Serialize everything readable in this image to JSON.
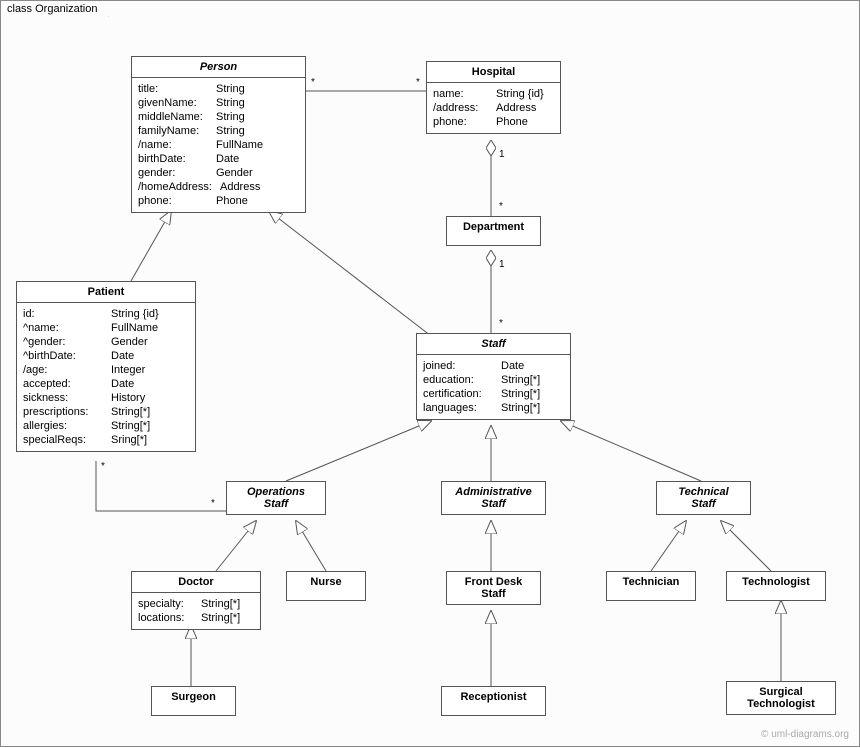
{
  "frame": {
    "label": "class Organization"
  },
  "watermark": "© uml-diagrams.org",
  "classes": {
    "person": {
      "name": "Person",
      "attrs": [
        {
          "n": "title:",
          "t": "String"
        },
        {
          "n": "givenName:",
          "t": "String"
        },
        {
          "n": "middleName:",
          "t": "String"
        },
        {
          "n": "familyName:",
          "t": "String"
        },
        {
          "n": "/name:",
          "t": "FullName"
        },
        {
          "n": "birthDate:",
          "t": "Date"
        },
        {
          "n": "gender:",
          "t": "Gender"
        },
        {
          "n": "/homeAddress:",
          "t": "Address"
        },
        {
          "n": "phone:",
          "t": "Phone"
        }
      ]
    },
    "hospital": {
      "name": "Hospital",
      "attrs": [
        {
          "n": "name:",
          "t": "String {id}"
        },
        {
          "n": "/address:",
          "t": "Address"
        },
        {
          "n": "phone:",
          "t": "Phone"
        }
      ]
    },
    "department": {
      "name": "Department"
    },
    "patient": {
      "name": "Patient",
      "attrs": [
        {
          "n": "id:",
          "t": "String {id}"
        },
        {
          "n": "^name:",
          "t": "FullName"
        },
        {
          "n": "^gender:",
          "t": "Gender"
        },
        {
          "n": "^birthDate:",
          "t": "Date"
        },
        {
          "n": "/age:",
          "t": "Integer"
        },
        {
          "n": "accepted:",
          "t": "Date"
        },
        {
          "n": "sickness:",
          "t": "History"
        },
        {
          "n": "prescriptions:",
          "t": "String[*]"
        },
        {
          "n": "allergies:",
          "t": "String[*]"
        },
        {
          "n": "specialReqs:",
          "t": "Sring[*]"
        }
      ]
    },
    "staff": {
      "name": "Staff",
      "attrs": [
        {
          "n": "joined:",
          "t": "Date"
        },
        {
          "n": "education:",
          "t": "String[*]"
        },
        {
          "n": "certification:",
          "t": "String[*]"
        },
        {
          "n": "languages:",
          "t": "String[*]"
        }
      ]
    },
    "operationsStaff": {
      "name": "Operations",
      "name2": "Staff"
    },
    "administrativeStaff": {
      "name": "Administrative",
      "name2": "Staff"
    },
    "technicalStaff": {
      "name": "Technical",
      "name2": "Staff"
    },
    "doctor": {
      "name": "Doctor",
      "attrs": [
        {
          "n": "specialty:",
          "t": "String[*]"
        },
        {
          "n": "locations:",
          "t": "String[*]"
        }
      ]
    },
    "nurse": {
      "name": "Nurse"
    },
    "frontDeskStaff": {
      "name": "Front Desk",
      "name2": "Staff"
    },
    "receptionist": {
      "name": "Receptionist"
    },
    "technician": {
      "name": "Technician"
    },
    "technologist": {
      "name": "Technologist"
    },
    "surgicalTechnologist": {
      "name": "Surgical",
      "name2": "Technologist"
    },
    "surgeon": {
      "name": "Surgeon"
    }
  },
  "mult": {
    "person_hospital_l": "*",
    "person_hospital_r": "*",
    "hospital_dept_top": "1",
    "hospital_dept_bot": "*",
    "dept_staff_top": "1",
    "dept_staff_bot": "*",
    "patient_ops_l": "*",
    "patient_ops_r": "*"
  }
}
